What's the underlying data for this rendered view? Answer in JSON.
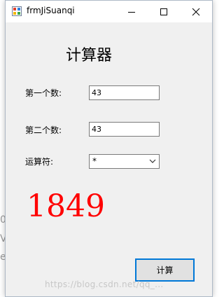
{
  "window": {
    "title": "frmJiSuanqi",
    "controls": [
      "minimize",
      "maximize",
      "close"
    ]
  },
  "form": {
    "heading": "计算器",
    "first_label": "第一个数:",
    "first_value": "43",
    "second_label": "第二个数:",
    "second_value": "43",
    "operator_label": "运算符:",
    "operator_value": "*",
    "result": "1849",
    "calc_button": "计算"
  },
  "background": {
    "fragments": [
      "0",
      "V",
      "e"
    ],
    "watermark": "https://blog.csdn.net/qq_..."
  },
  "colors": {
    "result": "#ff0000",
    "button_border": "#0078d7",
    "window_bg": "#f0f0f0"
  },
  "icons": {
    "app": "app-icon",
    "minimize": "minimize-icon",
    "maximize": "maximize-icon",
    "close": "close-icon",
    "dropdown": "chevron-down-icon"
  }
}
